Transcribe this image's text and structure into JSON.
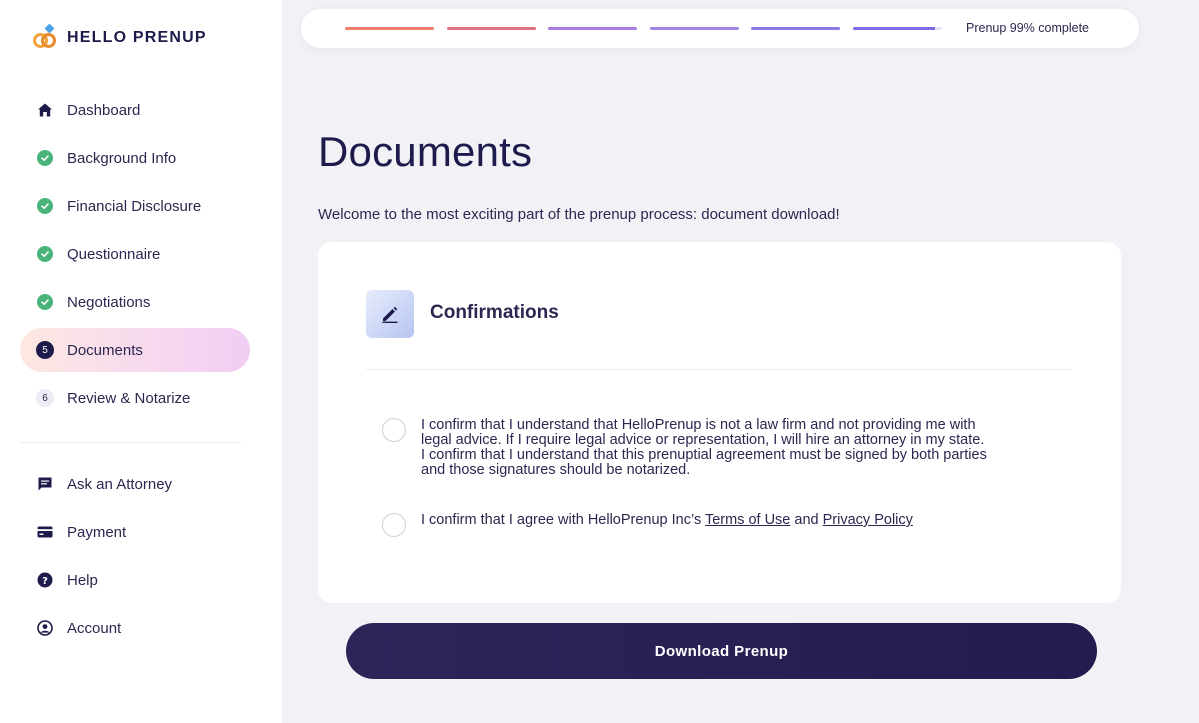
{
  "brand": {
    "name": "HELLO PRENUP"
  },
  "sidebar": {
    "items": [
      {
        "label": "Dashboard",
        "icon": "home-icon",
        "state": "default"
      },
      {
        "label": "Background Info",
        "icon": "check-circle-icon",
        "state": "done"
      },
      {
        "label": "Financial Disclosure",
        "icon": "check-circle-icon",
        "state": "done"
      },
      {
        "label": "Questionnaire",
        "icon": "check-circle-icon",
        "state": "done"
      },
      {
        "label": "Negotiations",
        "icon": "check-circle-icon",
        "state": "done"
      },
      {
        "label": "Documents",
        "icon": "step-number",
        "step": "5",
        "state": "active"
      },
      {
        "label": "Review & Notarize",
        "icon": "step-number",
        "step": "6",
        "state": "pending"
      }
    ],
    "secondary": [
      {
        "label": "Ask an Attorney",
        "icon": "chat-icon"
      },
      {
        "label": "Payment",
        "icon": "credit-card-icon"
      },
      {
        "label": "Help",
        "icon": "help-icon"
      },
      {
        "label": "Account",
        "icon": "account-icon"
      }
    ]
  },
  "progress": {
    "label": "Prenup 99% complete",
    "percent": 99,
    "segment_colors": [
      "#ee7f6c",
      "#e0707f",
      "#a87ee0",
      "#9f86e2",
      "#8f78e8",
      "#7c6ae6"
    ]
  },
  "main": {
    "title": "Documents",
    "subtitle": "Welcome to the most exciting part of the prenup process: document download!",
    "card": {
      "title": "Confirmations",
      "icon": "pencil-icon",
      "confirmations": [
        {
          "line1": "I confirm that I understand that HelloPrenup is not a law firm and not providing me with",
          "line2": "legal advice. If I require legal advice or representation, I will hire an attorney in my state.",
          "line3": "I confirm that I understand that this prenuptial agreement must be signed by both parties",
          "line4": "and those signatures should be notarized."
        },
        {
          "prefix": "I confirm that I agree with HelloPrenup Inc’s ",
          "terms_link": "Terms of Use",
          "middle": " and ",
          "privacy_link": "Privacy Policy"
        }
      ]
    },
    "download_button": "Download Prenup"
  },
  "colors": {
    "navy": "#1d1b4b",
    "done_green": "#49b37a",
    "button": "#2b2558"
  }
}
